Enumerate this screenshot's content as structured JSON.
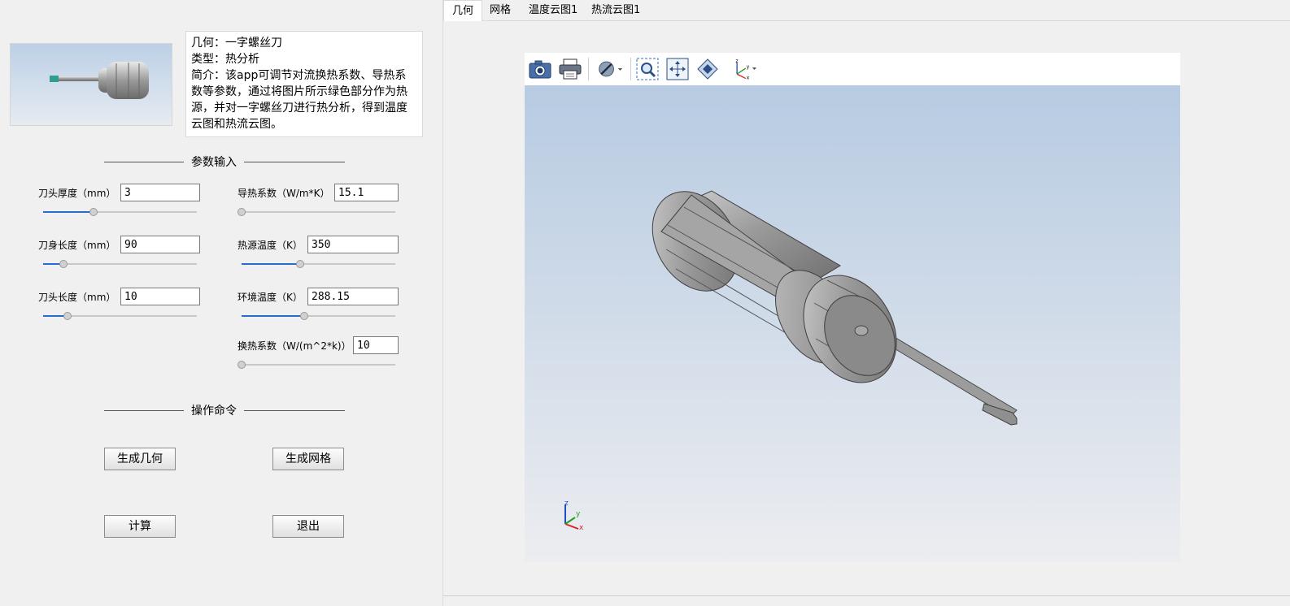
{
  "description": {
    "lines": [
      "几何：一字螺丝刀",
      "类型：热分析",
      "简介：该app可调节对流换热系数、导热系数等参数，通过将图片所示绿色部分作为热源，并对一字螺丝刀进行热分析，得到温度云图和热流云图。"
    ]
  },
  "params_section": {
    "title": "参数输入"
  },
  "params_left": [
    {
      "label": "刀头厚度（mm）",
      "value": "3",
      "slider_fraction": 0.33
    },
    {
      "label": "刀身长度（mm）",
      "value": "90",
      "slider_fraction": 0.13
    },
    {
      "label": "刀头长度（mm）",
      "value": "10",
      "slider_fraction": 0.16
    }
  ],
  "params_right": [
    {
      "label": "导热系数（W/m*K）",
      "value": "15.1",
      "slider_fraction": 0.0
    },
    {
      "label": "热源温度（K）",
      "value": "350",
      "slider_fraction": 0.38
    },
    {
      "label": "环境温度（K）",
      "value": "288.15",
      "slider_fraction": 0.41
    },
    {
      "label": "换热系数（W/(m^2*k)）",
      "value": "10",
      "slider_fraction": 0.0
    }
  ],
  "commands_section": {
    "title": "操作命令"
  },
  "buttons": {
    "generate_geometry": "生成几何",
    "generate_mesh": "生成网格",
    "compute": "计算",
    "exit": "退出"
  },
  "tabs": [
    {
      "label": "几何",
      "active": true
    },
    {
      "label": "网格",
      "active": false
    },
    {
      "label": "温度云图1",
      "active": false
    },
    {
      "label": "热流云图1",
      "active": false
    }
  ],
  "toolbar_icons": [
    "camera-icon",
    "print-icon",
    "hide-icon",
    "zoom-box-icon",
    "zoom-extents-icon",
    "fit-view-icon",
    "axis-orientation-icon"
  ],
  "axis_triad": {
    "x": "x",
    "y": "y",
    "z": "z"
  },
  "colors": {
    "slider_fill": "#2a6ccc",
    "heat_source": "#2e9e8e",
    "viewport_top": "#b7cbe2",
    "viewport_bottom": "#ecedf0"
  }
}
